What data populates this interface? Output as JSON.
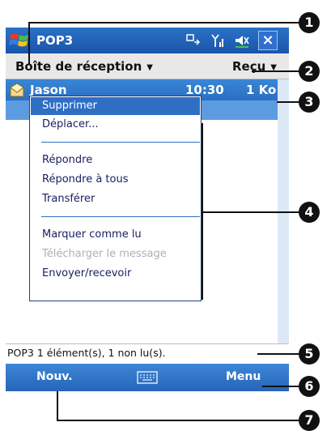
{
  "titlebar": {
    "app_title": "POP3",
    "close_glyph": "×",
    "icons": [
      "windows-start-icon",
      "sync-icon",
      "signal-icon",
      "volume-icon"
    ]
  },
  "filterbar": {
    "folder_label": "Boîte de réception",
    "sort_label": "Reçu",
    "caret": "▼"
  },
  "message": {
    "sender": "Jason",
    "time": "10:30",
    "size": "1 Ko"
  },
  "context_menu": {
    "items": [
      {
        "label": "Supprimer",
        "selected": true,
        "enabled": true
      },
      {
        "label": "Déplacer...",
        "selected": false,
        "enabled": true
      },
      {
        "label": "Répondre",
        "selected": false,
        "enabled": true
      },
      {
        "label": "Répondre à tous",
        "selected": false,
        "enabled": true
      },
      {
        "label": "Transférer",
        "selected": false,
        "enabled": true
      },
      {
        "label": "Marquer comme lu",
        "selected": false,
        "enabled": true
      },
      {
        "label": "Télécharger le message",
        "selected": false,
        "enabled": false
      },
      {
        "label": "Envoyer/recevoir",
        "selected": false,
        "enabled": true
      }
    ]
  },
  "status": {
    "text": "POP3  1 élément(s), 1 non lu(s)."
  },
  "softkeys": {
    "left": "Nouv.",
    "right": "Menu"
  },
  "callouts": [
    "1",
    "2",
    "3",
    "4",
    "5",
    "6",
    "7"
  ],
  "colors": {
    "accent": "#2a6fc2",
    "selection": "#2e6fc4",
    "disabled": "#aab0b8"
  }
}
